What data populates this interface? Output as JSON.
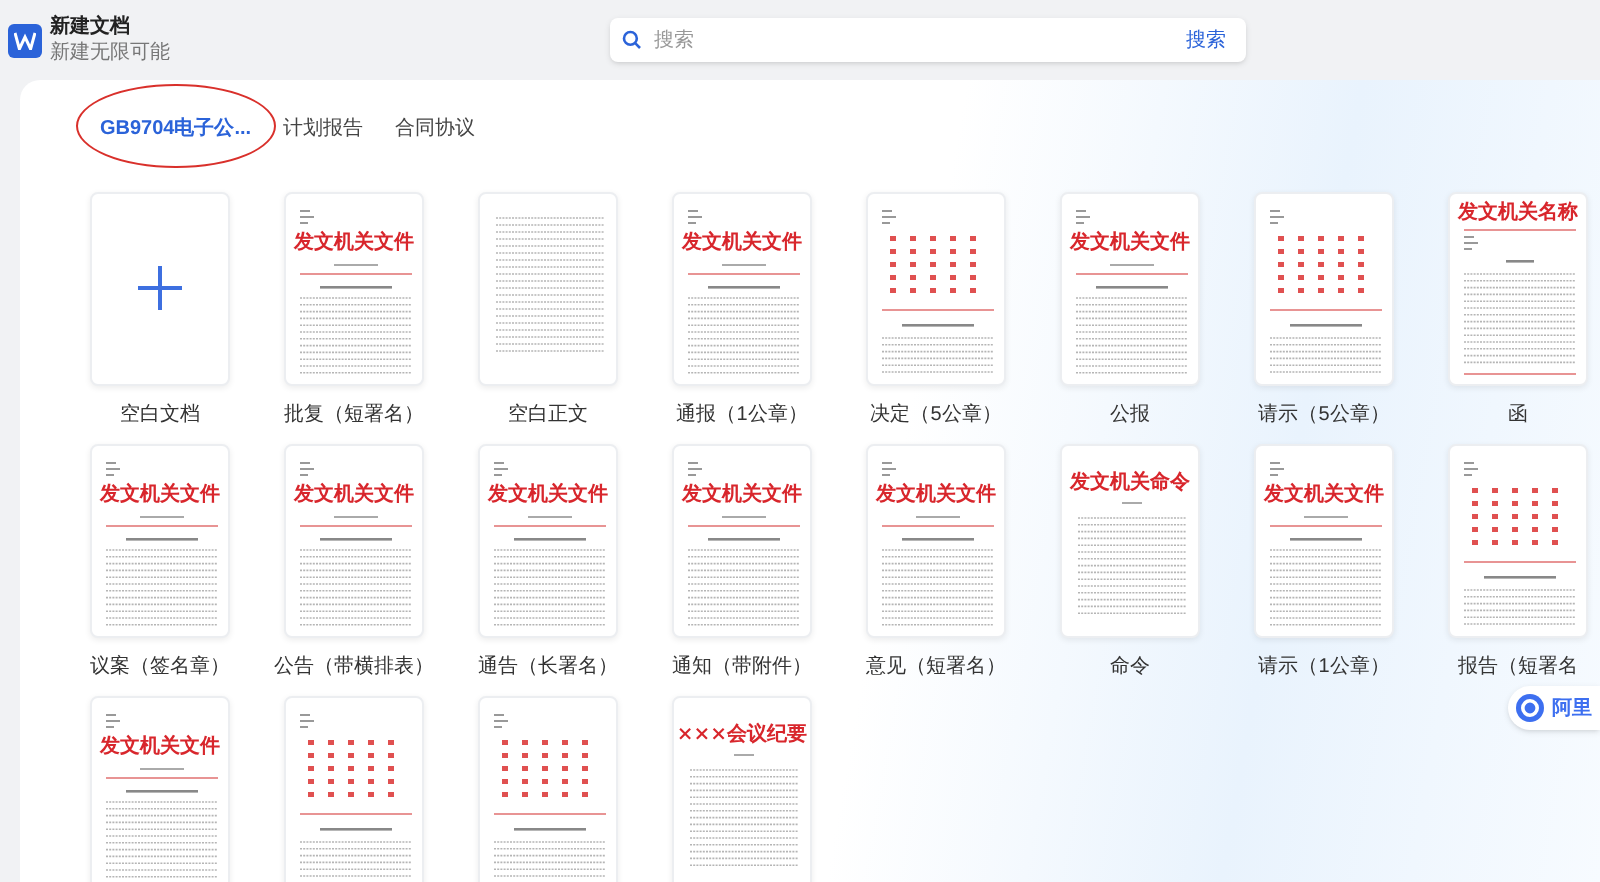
{
  "app": {
    "title": "新建文档",
    "subtitle": "新建无限可能"
  },
  "search": {
    "placeholder": "搜索",
    "button": "搜索"
  },
  "tabs": [
    {
      "label": "GB9704电子公...",
      "selected": true,
      "circled": true
    },
    {
      "label": "计划报告",
      "selected": false,
      "circled": false
    },
    {
      "label": "合同协议",
      "selected": false,
      "circled": false
    }
  ],
  "templates": [
    {
      "kind": "blank",
      "label": "空白文档"
    },
    {
      "kind": "doc",
      "heading": "发文机关文件",
      "label": "批复（短署名）"
    },
    {
      "kind": "plain",
      "label": "空白正文"
    },
    {
      "kind": "doc",
      "heading": "发文机关文件",
      "label": "通报（1公章）"
    },
    {
      "kind": "joint",
      "label": "决定（5公章）"
    },
    {
      "kind": "doc",
      "heading": "发文机关文件",
      "label": "公报"
    },
    {
      "kind": "joint",
      "label": "请示（5公章）"
    },
    {
      "kind": "letter",
      "heading": "发文机关名称",
      "label": "函"
    },
    {
      "kind": "doc",
      "heading": "发文机关文件",
      "label": "议案（签名章）"
    },
    {
      "kind": "doc",
      "heading": "发文机关文件",
      "label": "公告（带横排表）"
    },
    {
      "kind": "doc",
      "heading": "发文机关文件",
      "label": "通告（长署名）"
    },
    {
      "kind": "doc",
      "heading": "发文机关文件",
      "label": "通知（带附件）"
    },
    {
      "kind": "doc",
      "heading": "发文机关文件",
      "label": "意见（短署名）"
    },
    {
      "kind": "order",
      "heading": "发文机关命令",
      "label": "命令"
    },
    {
      "kind": "doc",
      "heading": "发文机关文件",
      "label": "请示（1公章）"
    },
    {
      "kind": "joint",
      "label": "报告（短署名"
    },
    {
      "kind": "doc",
      "heading": "发文机关文件"
    },
    {
      "kind": "joint"
    },
    {
      "kind": "joint"
    },
    {
      "kind": "order",
      "heading": "×××会议纪要"
    }
  ],
  "assistant": {
    "label": "阿里"
  }
}
